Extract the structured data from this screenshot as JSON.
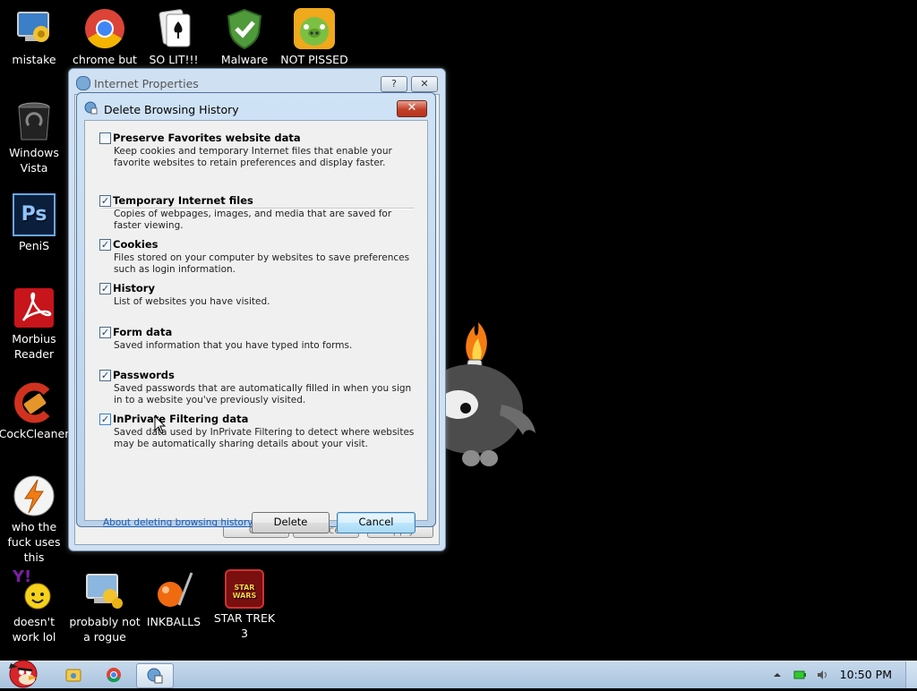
{
  "desktop": {
    "icons": [
      {
        "label": "mistake",
        "icon": "computer-settings-icon"
      },
      {
        "label": "chrome but",
        "icon": "chrome-icon"
      },
      {
        "label": "SO LIT!!!",
        "icon": "solitaire-icon"
      },
      {
        "label": "Malware",
        "icon": "shield-check-icon"
      },
      {
        "label": "NOT PISSED",
        "icon": "angry-birds-pig-icon"
      },
      {
        "label": "Windows Vista",
        "icon": "trash-bin-icon"
      },
      {
        "label": "PeniS",
        "icon": "photoshop-icon",
        "glyph": "Ps"
      },
      {
        "label": "Morbius Reader",
        "icon": "acrobat-reader-icon"
      },
      {
        "label": "CockCleaner",
        "icon": "ccleaner-icon"
      },
      {
        "label": "who the fuck uses this",
        "icon": "winamp-bolt-icon"
      },
      {
        "label": "doesn't work lol",
        "icon": "yahoo-messenger-icon",
        "glyph": "Y!"
      },
      {
        "label": "probably not a rogue",
        "icon": "computer-gears-icon"
      },
      {
        "label": "INKBALLS",
        "icon": "inkball-icon"
      },
      {
        "label": "STAR TREK 3",
        "icon": "star-wars-angry-birds-icon",
        "glyph": "STAR WARS"
      }
    ]
  },
  "back_window": {
    "title": "Internet Properties",
    "help_label": "?",
    "close_label": "✕",
    "ok_label": "OK",
    "cancel_label": "Cancel",
    "apply_label": "Apply"
  },
  "dialog": {
    "title": "Delete Browsing History",
    "close_label": "✕",
    "items": [
      {
        "title": "Preserve Favorites website data",
        "checked": false,
        "mark": "",
        "desc": "Keep cookies and temporary Internet files that enable your favorite websites to retain preferences and display faster."
      },
      {
        "title": "Temporary Internet files",
        "checked": true,
        "mark": "✓",
        "desc": "Copies of webpages, images, and media that are saved for faster viewing."
      },
      {
        "title": "Cookies",
        "checked": true,
        "mark": "✓",
        "desc": "Files stored on your computer by websites to save preferences such as login information."
      },
      {
        "title": "History",
        "checked": true,
        "mark": "✓",
        "desc": "List of websites you have visited."
      },
      {
        "title": "Form data",
        "checked": true,
        "mark": "✓",
        "desc": "Saved information that you have typed into forms."
      },
      {
        "title": "Passwords",
        "checked": true,
        "mark": "✓",
        "desc": "Saved passwords that are automatically filled in when you sign in to a website you've previously visited."
      },
      {
        "title": "InPrivate Filtering data",
        "checked": true,
        "mark": "✓",
        "desc": "Saved data used by InPrivate Filtering to detect where websites may be automatically sharing details about your visit."
      }
    ],
    "link_text": "About deleting browsing history",
    "delete_label": "Delete",
    "cancel_label": "Cancel"
  },
  "taskbar": {
    "start_icon": "angry-bird-start-icon",
    "pinned": [
      "explorer-icon",
      "chrome-icon",
      "internet-options-icon"
    ],
    "tray_icons": [
      "arrow-up-icon",
      "battery-icon",
      "volume-icon"
    ],
    "clock": "10:50 PM"
  },
  "colors": {
    "desktop_bg": "#000000",
    "dialog_close": "#c2402a",
    "link": "#1a5bb5"
  }
}
